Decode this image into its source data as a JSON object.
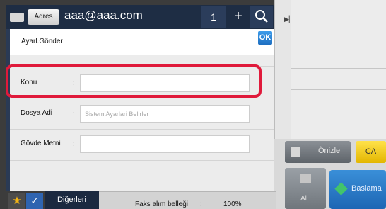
{
  "address_bar": {
    "address_button": "Adres",
    "email": "aaa@aaa.com",
    "count": "1",
    "add_symbol": "+"
  },
  "dialog": {
    "title": "Ayarl.Gönder",
    "ok_label": "OK",
    "fields": [
      {
        "label": "Konu",
        "value": "",
        "placeholder": ""
      },
      {
        "label": "Dosya Adi",
        "value": "",
        "placeholder": "Sistem Ayarlari Belirler"
      },
      {
        "label": "Gövde Metni",
        "value": "",
        "placeholder": ""
      }
    ],
    "field_separator": ":",
    "highlight_color": "#e01a3b"
  },
  "main_screen": {
    "preview_label": "Önizle",
    "ca_label": "CA",
    "bw_label": "Al",
    "start_label": "Baslama",
    "others_label": "Diğerleri",
    "fax_memory_label": "Faks alım belleği",
    "fax_memory_sep": ":",
    "fax_memory_value": "100%"
  },
  "colors": {
    "ok_button": "#1e6fc1",
    "ca_button": "#f2c200",
    "start_button": "#1d66b4",
    "favorite_star": "#f2b315"
  }
}
